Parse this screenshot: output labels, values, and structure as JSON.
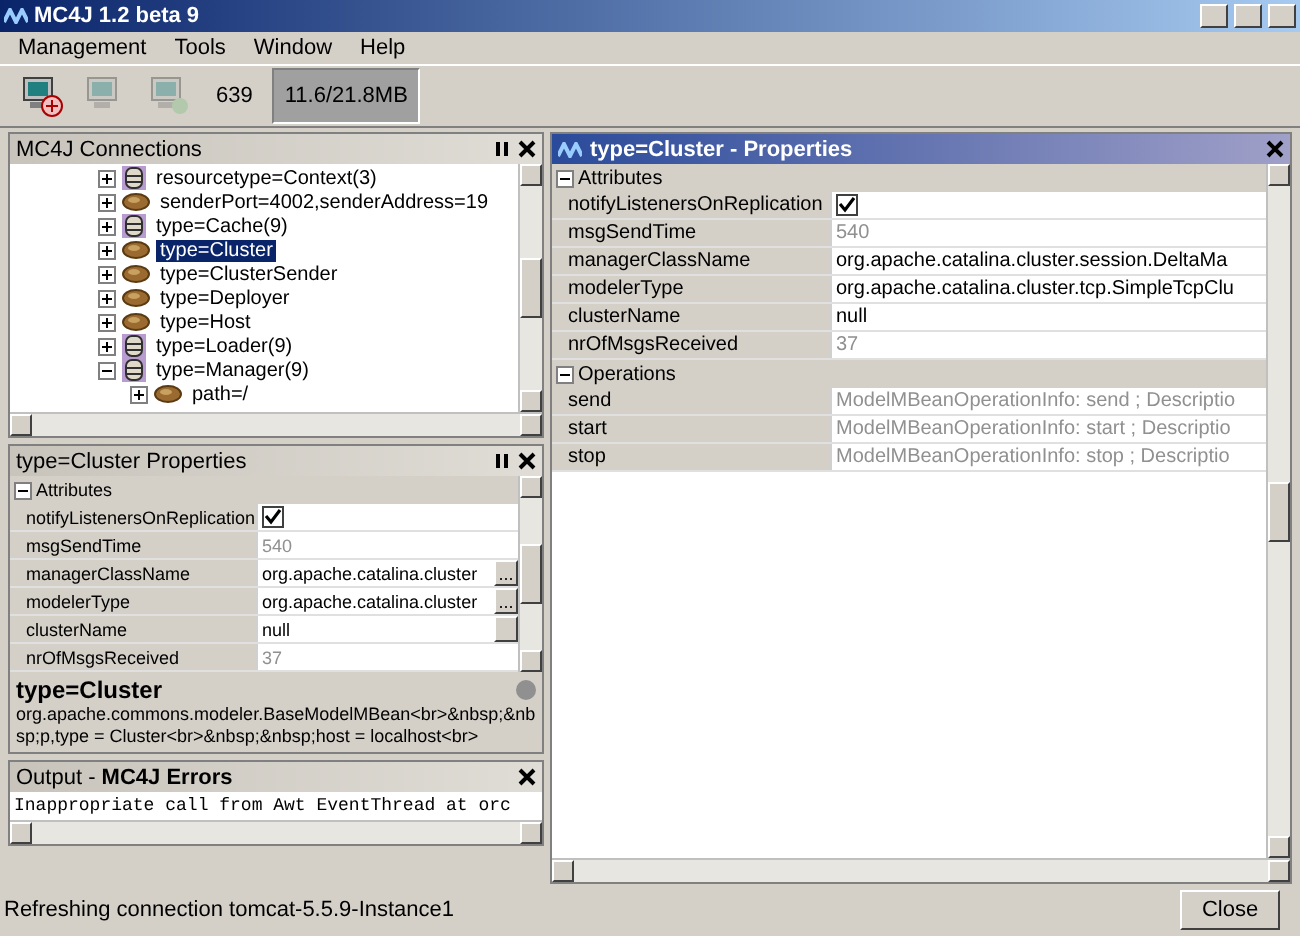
{
  "window": {
    "title": "MC4J 1.2 beta 9"
  },
  "menu": [
    "Management",
    "Tools",
    "Window",
    "Help"
  ],
  "toolbar": {
    "buttons": [
      {
        "kind": "connect",
        "disabled": false
      },
      {
        "kind": "computer",
        "disabled": true
      },
      {
        "kind": "refresh",
        "disabled": true
      }
    ],
    "count": "639",
    "memory": "11.6/21.8MB"
  },
  "connections": {
    "title": "MC4J Connections",
    "active": false,
    "tree": [
      {
        "label": "resourcetype=Context(3)",
        "kind": "group",
        "expanded": false,
        "selected": false
      },
      {
        "label": "senderPort=4002,senderAddress=19",
        "kind": "bean",
        "expanded": false,
        "selected": false
      },
      {
        "label": "type=Cache(9)",
        "kind": "group",
        "expanded": false,
        "selected": false
      },
      {
        "label": "type=Cluster",
        "kind": "bean",
        "expanded": false,
        "selected": true
      },
      {
        "label": "type=ClusterSender",
        "kind": "bean",
        "expanded": false,
        "selected": false
      },
      {
        "label": "type=Deployer",
        "kind": "bean",
        "expanded": false,
        "selected": false
      },
      {
        "label": "type=Host",
        "kind": "bean",
        "expanded": false,
        "selected": false
      },
      {
        "label": "type=Loader(9)",
        "kind": "group",
        "expanded": false,
        "selected": false
      },
      {
        "label": "type=Manager(9)",
        "kind": "group",
        "expanded": true,
        "selected": false,
        "children": [
          {
            "label": "path=/",
            "kind": "bean",
            "expanded": false,
            "selected": false
          }
        ]
      }
    ]
  },
  "left_properties": {
    "title": "type=Cluster  Properties",
    "active": false,
    "sections": [
      {
        "title": "Attributes",
        "expanded": true,
        "rows": [
          {
            "name": "notifyListenersOnReplication",
            "kind": "checkbox",
            "checked": true,
            "editable": true
          },
          {
            "name": "msgSendTime",
            "kind": "text",
            "value": "540",
            "editable": false
          },
          {
            "name": "managerClassName",
            "kind": "text",
            "value": "org.apache.catalina.cluster",
            "editable": true,
            "editor_label": "..."
          },
          {
            "name": "modelerType",
            "kind": "text",
            "value": "org.apache.catalina.cluster",
            "editable": true,
            "editor_label": "..."
          },
          {
            "name": "clusterName",
            "kind": "text",
            "value": "null",
            "editable": true,
            "editor_label": ""
          },
          {
            "name": "nrOfMsgsReceived",
            "kind": "text",
            "value": "37",
            "editable": false
          }
        ]
      }
    ],
    "description": {
      "title": "type=Cluster",
      "text": "org.apache.commons.modeler.BaseModelMBean<br>&nbsp;&nbsp;p,type = Cluster<br>&nbsp;&nbsp;host = localhost<br>"
    }
  },
  "output": {
    "title": "Output - **MC4J Errors**",
    "active": false,
    "lines": [
      "Inappropriate call from Awt EventThread at orc"
    ]
  },
  "right_properties": {
    "title": "type=Cluster - Properties",
    "active": true,
    "sections": [
      {
        "title": "Attributes",
        "expanded": true,
        "rows": [
          {
            "name": "notifyListenersOnReplication",
            "kind": "checkbox",
            "checked": true,
            "editable": true
          },
          {
            "name": "msgSendTime",
            "kind": "text",
            "value": "540",
            "editable": false
          },
          {
            "name": "managerClassName",
            "kind": "text",
            "value": "org.apache.catalina.cluster.session.DeltaMa",
            "editable": true
          },
          {
            "name": "modelerType",
            "kind": "text",
            "value": "org.apache.catalina.cluster.tcp.SimpleTcpClu",
            "editable": true
          },
          {
            "name": "clusterName",
            "kind": "text",
            "value": "null",
            "editable": true
          },
          {
            "name": "nrOfMsgsReceived",
            "kind": "text",
            "value": "37",
            "editable": false
          }
        ]
      },
      {
        "title": "Operations",
        "expanded": true,
        "rows": [
          {
            "name": "send",
            "kind": "text",
            "value": "ModelMBeanOperationInfo: send ; Descriptio",
            "editable": false
          },
          {
            "name": "start",
            "kind": "text",
            "value": "ModelMBeanOperationInfo: start ; Descriptio",
            "editable": false
          },
          {
            "name": "stop",
            "kind": "text",
            "value": "ModelMBeanOperationInfo: stop ; Descriptio",
            "editable": false
          }
        ]
      }
    ]
  },
  "status_bar": {
    "text": "Refreshing connection tomcat-5.5.9-Instance1"
  },
  "buttons": [
    "Close"
  ]
}
